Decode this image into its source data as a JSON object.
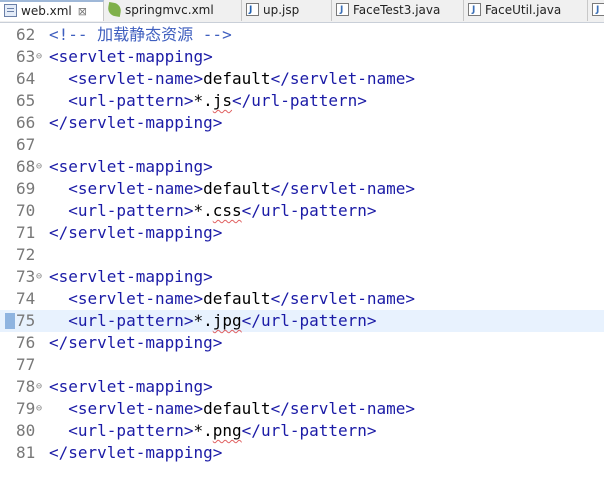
{
  "tabs": [
    {
      "label": "web.xml",
      "icon": "xml-file-icon",
      "active": true,
      "close": "⊠"
    },
    {
      "label": "springmvc.xml",
      "icon": "spring-leaf-icon",
      "active": false
    },
    {
      "label": "up.jsp",
      "icon": "jsp-file-icon",
      "active": false
    },
    {
      "label": "FaceTest3.java",
      "icon": "java-file-icon",
      "active": false
    },
    {
      "label": "FaceUtil.java",
      "icon": "java-file-icon",
      "active": false
    }
  ],
  "lines": [
    {
      "num": "62",
      "fold": "",
      "indent": "",
      "parts": [
        {
          "t": "cmt",
          "v": "<!-- 加载静态资源 -->"
        }
      ]
    },
    {
      "num": "63",
      "fold": "⊖",
      "indent": "",
      "parts": [
        {
          "t": "tag",
          "v": "<servlet-mapping>"
        }
      ]
    },
    {
      "num": "64",
      "fold": "",
      "indent": "  ",
      "parts": [
        {
          "t": "tag",
          "v": "<servlet-name>"
        },
        {
          "t": "txt",
          "v": "default"
        },
        {
          "t": "tag",
          "v": "</servlet-name>"
        }
      ]
    },
    {
      "num": "65",
      "fold": "",
      "indent": "  ",
      "parts": [
        {
          "t": "tag",
          "v": "<url-pattern>"
        },
        {
          "t": "txt",
          "v": "*."
        },
        {
          "t": "sq",
          "v": "js"
        },
        {
          "t": "tag",
          "v": "</url-pattern>"
        }
      ]
    },
    {
      "num": "66",
      "fold": "",
      "indent": "",
      "parts": [
        {
          "t": "tag",
          "v": "</servlet-mapping>"
        }
      ]
    },
    {
      "num": "67",
      "fold": "",
      "indent": "",
      "parts": []
    },
    {
      "num": "68",
      "fold": "⊖",
      "indent": "",
      "parts": [
        {
          "t": "tag",
          "v": "<servlet-mapping>"
        }
      ]
    },
    {
      "num": "69",
      "fold": "",
      "indent": "  ",
      "parts": [
        {
          "t": "tag",
          "v": "<servlet-name>"
        },
        {
          "t": "txt",
          "v": "default"
        },
        {
          "t": "tag",
          "v": "</servlet-name>"
        }
      ]
    },
    {
      "num": "70",
      "fold": "",
      "indent": "  ",
      "parts": [
        {
          "t": "tag",
          "v": "<url-pattern>"
        },
        {
          "t": "txt",
          "v": "*."
        },
        {
          "t": "sq",
          "v": "css"
        },
        {
          "t": "tag",
          "v": "</url-pattern>"
        }
      ]
    },
    {
      "num": "71",
      "fold": "",
      "indent": "",
      "parts": [
        {
          "t": "tag",
          "v": "</servlet-mapping>"
        }
      ]
    },
    {
      "num": "72",
      "fold": "",
      "indent": "",
      "parts": []
    },
    {
      "num": "73",
      "fold": "⊖",
      "indent": "",
      "parts": [
        {
          "t": "tag",
          "v": "<servlet-mapping>"
        }
      ]
    },
    {
      "num": "74",
      "fold": "",
      "indent": "  ",
      "parts": [
        {
          "t": "tag",
          "v": "<servlet-name>"
        },
        {
          "t": "txt",
          "v": "default"
        },
        {
          "t": "tag",
          "v": "</servlet-name>"
        }
      ]
    },
    {
      "num": "75",
      "fold": "",
      "indent": "  ",
      "current": true,
      "parts": [
        {
          "t": "tag",
          "v": "<url-pattern>"
        },
        {
          "t": "txt",
          "v": "*."
        },
        {
          "t": "sq",
          "v": "jpg"
        },
        {
          "t": "tag",
          "v": "</url-pattern>"
        }
      ]
    },
    {
      "num": "76",
      "fold": "",
      "indent": "",
      "parts": [
        {
          "t": "tag",
          "v": "</servlet-mapping>"
        }
      ]
    },
    {
      "num": "77",
      "fold": "",
      "indent": "",
      "parts": []
    },
    {
      "num": "78",
      "fold": "⊖",
      "indent": "",
      "parts": [
        {
          "t": "tag",
          "v": "<servlet-mapping>"
        }
      ]
    },
    {
      "num": "79",
      "fold": "⊖",
      "indent": "  ",
      "parts": [
        {
          "t": "tag",
          "v": "<servlet-name>"
        },
        {
          "t": "txt",
          "v": "default"
        },
        {
          "t": "tag",
          "v": "</servlet-name>"
        }
      ]
    },
    {
      "num": "80",
      "fold": "",
      "indent": "  ",
      "parts": [
        {
          "t": "tag",
          "v": "<url-pattern>"
        },
        {
          "t": "txt",
          "v": "*."
        },
        {
          "t": "sq",
          "v": "png"
        },
        {
          "t": "tag",
          "v": "</url-pattern>"
        }
      ]
    },
    {
      "num": "81",
      "fold": "",
      "indent": "",
      "parts": [
        {
          "t": "tag",
          "v": "</servlet-mapping>"
        }
      ]
    }
  ]
}
